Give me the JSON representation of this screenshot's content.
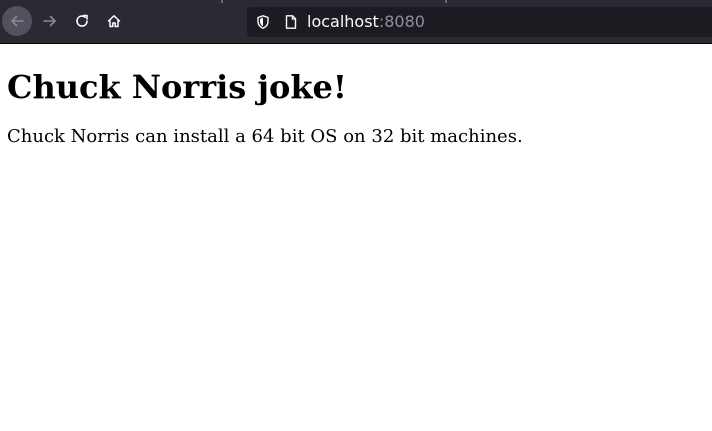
{
  "browser": {
    "url_host": "localhost",
    "url_port": ":8080",
    "icons": {
      "back": "arrow-left-icon",
      "forward": "arrow-right-icon",
      "reload": "reload-icon",
      "home": "home-icon",
      "shield": "shield-icon",
      "page": "page-icon"
    }
  },
  "page": {
    "heading": "Chuck Norris joke!",
    "joke": "Chuck Norris can install a 64 bit OS on 32 bit machines."
  },
  "colors": {
    "toolbar_bg": "#2b2a33",
    "urlbar_bg": "#1c1b22",
    "url_text": "#fbfbfe",
    "url_port": "#8f8f9d"
  }
}
